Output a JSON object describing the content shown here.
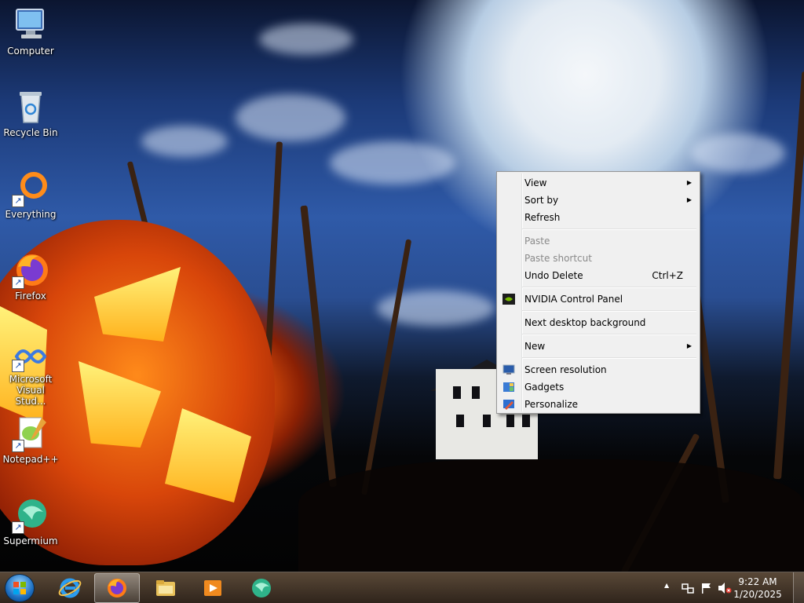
{
  "desktop": {
    "icons": [
      {
        "label": "Computer",
        "icon": "computer-icon",
        "shortcut": false
      },
      {
        "label": "Recycle Bin",
        "icon": "recycle-bin-icon",
        "shortcut": false
      },
      {
        "label": "Everything",
        "icon": "everything-icon",
        "shortcut": true
      },
      {
        "label": "Firefox",
        "icon": "firefox-icon",
        "shortcut": true
      },
      {
        "label": "Microsoft Visual Stud...",
        "icon": "visual-studio-icon",
        "shortcut": true
      },
      {
        "label": "Notepad++",
        "icon": "notepad-plus-plus-icon",
        "shortcut": true
      },
      {
        "label": "Supermium",
        "icon": "supermium-icon",
        "shortcut": true
      }
    ]
  },
  "context_menu": {
    "view": "View",
    "sort_by": "Sort by",
    "refresh": "Refresh",
    "paste": "Paste",
    "paste_shortcut": "Paste shortcut",
    "undo_delete": "Undo Delete",
    "undo_delete_key": "Ctrl+Z",
    "nvidia": "NVIDIA Control Panel",
    "next_background": "Next desktop background",
    "new": "New",
    "screen_resolution": "Screen resolution",
    "gadgets": "Gadgets",
    "personalize": "Personalize",
    "arrow_glyph": "▶"
  },
  "taskbar": {
    "pinned": [
      "start-orb",
      "internet-explorer-icon",
      "firefox-icon",
      "file-explorer-icon",
      "media-player-icon",
      "supermium-icon"
    ],
    "active": "firefox-icon",
    "tray_icons": [
      "show-hidden-icons-arrow",
      "network-icon",
      "action-center-flag-icon",
      "volume-muted-icon"
    ],
    "clock_time": "9:22 AM",
    "clock_date": "1/20/2025",
    "tray_arrow": "▲"
  },
  "colors": {
    "menu_bg": "#f0f0f0",
    "menu_disabled_text": "#8a8a8a",
    "taskbar_tint": "#3c2814"
  }
}
